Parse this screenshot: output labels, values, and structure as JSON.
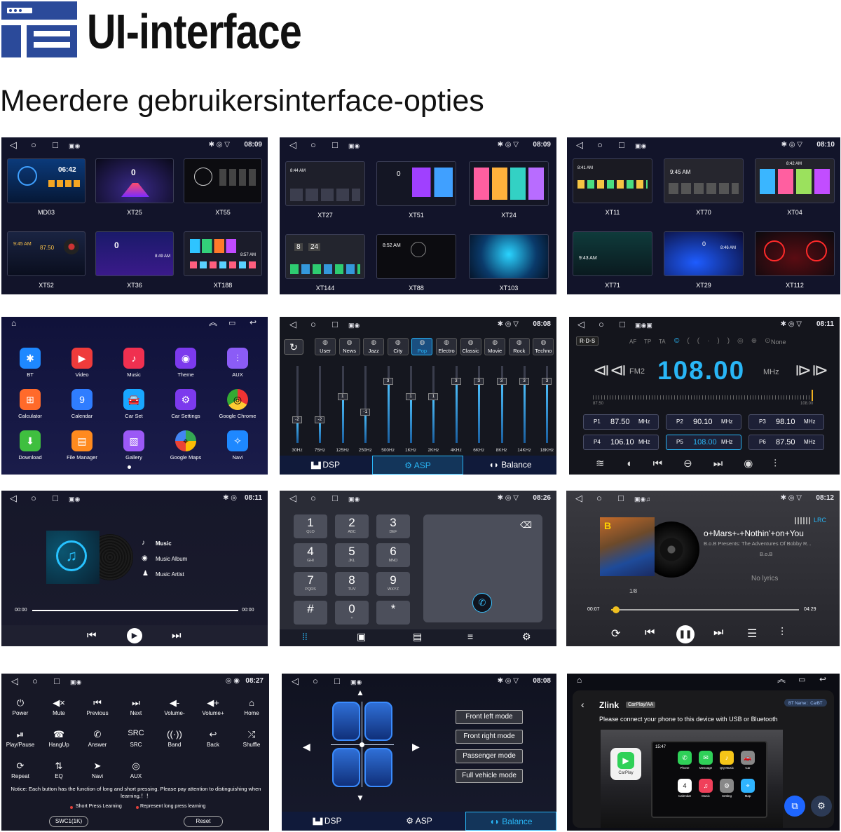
{
  "header": {
    "title": "UI-interface",
    "subtitle": "Meerdere gebruikersinterface-opties"
  },
  "colors": {
    "accent": "#29b6f6",
    "panel_bg": "#12142a",
    "logo_blue": "#2b4a9a"
  },
  "status": {
    "p1": "08:09",
    "p2": "08:09",
    "p3": "08:10",
    "p5": "08:08",
    "p6": "08:11",
    "p7": "08:11",
    "p8": "08:26",
    "p9": "08:12",
    "p10": "08:27",
    "p11": "08:08"
  },
  "themes": {
    "p1": [
      "MD03",
      "XT25",
      "XT55",
      "XT52",
      "XT36",
      "XT188"
    ],
    "p2": [
      "XT27",
      "XT51",
      "XT24",
      "XT144",
      "XT88",
      "XT103"
    ],
    "p3": [
      "XT11",
      "XT70",
      "XT04",
      "XT71",
      "XT29",
      "XT112"
    ]
  },
  "thumb_times": {
    "p1a": "06:42",
    "p1b": "9:45 AM",
    "p1c": "87.50",
    "p1d": "8:49 AM",
    "p1e": "8:57 AM",
    "p2a": "8:44 AM",
    "p2b": "8",
    "p2c": "24",
    "p2d": "8:52 AM",
    "p3a": "8:41 AM",
    "p3b": "9:45 AM",
    "p3c": "8:42 AM",
    "p3d": "9:43 AM",
    "p3e": "8:46 AM",
    "p3f": "0",
    "p1f": "0",
    "p1g": "0",
    "p1h": "0",
    "p2e": "0"
  },
  "apps": [
    "BT",
    "Video",
    "Music",
    "Theme",
    "AUX",
    "Calculator",
    "Calendar",
    "Car Set",
    "Car Settings",
    "Google Chrome",
    "Download",
    "File Manager",
    "Gallery",
    "Google Maps",
    "Navi"
  ],
  "calendar_day": "9",
  "eq": {
    "presets": [
      "User",
      "News",
      "Jazz",
      "City",
      "Pop",
      "Electro",
      "Classic",
      "Movie",
      "Rock",
      "Techno"
    ],
    "bands": [
      "30Hz",
      "75Hz",
      "125Hz",
      "250Hz",
      "500Hz",
      "1KHz",
      "2KHz",
      "4KHz",
      "6KHz",
      "8KHz",
      "14KHz",
      "18KHz"
    ],
    "band_values": [
      -2,
      -2,
      1,
      -1,
      3,
      1,
      1,
      3,
      3,
      3,
      3,
      3
    ],
    "tabs": [
      "DSP",
      "ASP",
      "Balance"
    ]
  },
  "radio": {
    "rds": "R·D·S",
    "flags": [
      "AF",
      "TP",
      "TA",
      "None"
    ],
    "band": "FM2",
    "freq": "108.00",
    "unit": "MHz",
    "scale_min": "87.50",
    "scale_max": "108.00",
    "presets": [
      {
        "p": "P1",
        "f": "87.50",
        "u": "MHz"
      },
      {
        "p": "P2",
        "f": "90.10",
        "u": "MHz"
      },
      {
        "p": "P3",
        "f": "98.10",
        "u": "MHz"
      },
      {
        "p": "P4",
        "f": "106.10",
        "u": "MHz"
      },
      {
        "p": "P5",
        "f": "108.00",
        "u": "MHz"
      },
      {
        "p": "P6",
        "f": "87.50",
        "u": "MHz"
      }
    ]
  },
  "music": {
    "menu": [
      "Music",
      "Music Album",
      "Music Artist"
    ],
    "t_start": "00:00",
    "t_end": "00:00"
  },
  "dialer": {
    "keys": [
      {
        "d": "1",
        "s": "QLO"
      },
      {
        "d": "2",
        "s": "ABC"
      },
      {
        "d": "3",
        "s": "DEF"
      },
      {
        "d": "4",
        "s": "GHI"
      },
      {
        "d": "5",
        "s": "JKL"
      },
      {
        "d": "6",
        "s": "MNO"
      },
      {
        "d": "7",
        "s": "PQRS"
      },
      {
        "d": "8",
        "s": "TUV"
      },
      {
        "d": "9",
        "s": "WXYZ"
      },
      {
        "d": "#",
        "s": ""
      },
      {
        "d": "0",
        "s": "+"
      },
      {
        "d": "*",
        "s": ""
      }
    ]
  },
  "player": {
    "lrc": "LRC",
    "song": "o+Mars+-+Nothin'+on+You",
    "album": "B.o.B Presents: The Adventures Of Bobby R...",
    "artist": "B.o.B",
    "no_lyrics": "No lyrics",
    "counter": "1/8",
    "t_start": "00:07",
    "t_end": "04:29",
    "progress": 0.02
  },
  "swc": {
    "buttons": [
      "Power",
      "Mute",
      "Previous",
      "Next",
      "Volume-",
      "Volume+",
      "Home",
      "Play/Pause",
      "HangUp",
      "Answer",
      "SRC",
      "Band",
      "Back",
      "Shuffle",
      "Repeat",
      "EQ",
      "Navi",
      "AUX"
    ],
    "src_glyph": "SRC",
    "notice": "Notice:  Each button has the function of long and short pressing. Please pay attention to distinguishing when learning.！！",
    "legend": [
      "Short Press Learning",
      "Represent long press learning"
    ],
    "profile": "SWC1(1K)",
    "reset": "Reset"
  },
  "seat": {
    "modes": [
      "Front left mode",
      "Front right mode",
      "Passenger mode",
      "Full vehicle mode"
    ],
    "tabs": [
      "DSP",
      "ASP",
      "Balance"
    ]
  },
  "zlink": {
    "title": "Zlink",
    "tag": "CarPlay/AA",
    "bt_name": "BT Name：CarBT",
    "message": "Please connect your phone to this device with USB or Bluetooth",
    "carplay": "CarPlay",
    "screen_time": "15:47",
    "apps": [
      "Phone",
      "Message",
      "QQ Music",
      "Car",
      "Calendar",
      "Music",
      "Setting",
      "Map"
    ],
    "cal_day": "4"
  }
}
